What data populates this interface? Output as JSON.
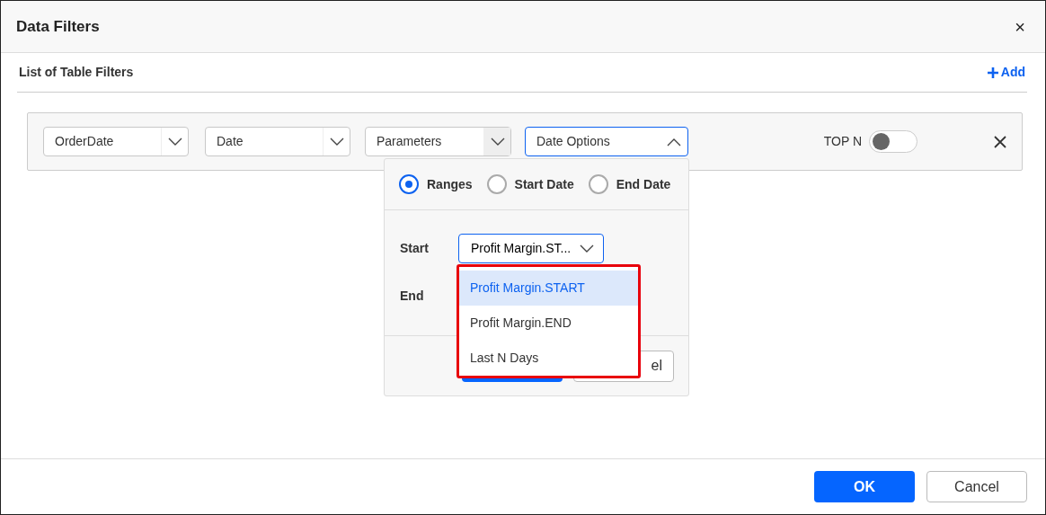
{
  "dialog": {
    "title": "Data Filters",
    "close": "×"
  },
  "section": {
    "title": "List of Table Filters",
    "add_label": "Add"
  },
  "filter_row": {
    "dropdowns": [
      {
        "value": "OrderDate",
        "expanded": false,
        "hovered": false
      },
      {
        "value": "Date",
        "expanded": false,
        "hovered": false
      },
      {
        "value": "Parameters",
        "expanded": false,
        "hovered": true
      },
      {
        "value": "Date Options",
        "expanded": true,
        "hovered": false
      }
    ],
    "top_n": {
      "label": "TOP N",
      "on": false
    }
  },
  "date_popup": {
    "options": [
      {
        "label": "Ranges",
        "selected": true
      },
      {
        "label": "Start Date",
        "selected": false
      },
      {
        "label": "End Date",
        "selected": false
      }
    ],
    "fields": [
      {
        "label": "Start",
        "value": "Profit Margin.ST..."
      },
      {
        "label": "End"
      }
    ],
    "buttons": [
      {
        "kind": "primary"
      },
      {
        "kind": "secondary",
        "visible_text": "el"
      }
    ]
  },
  "start_list": {
    "highlighted": true,
    "items": [
      {
        "label": "Profit Margin.START",
        "selected": true
      },
      {
        "label": "Profit Margin.END",
        "selected": false
      },
      {
        "label": "Last N Days",
        "selected": false
      }
    ]
  },
  "footer": {
    "buttons": [
      {
        "label": "OK",
        "kind": "primary"
      },
      {
        "label": "Cancel",
        "kind": "secondary"
      }
    ]
  }
}
